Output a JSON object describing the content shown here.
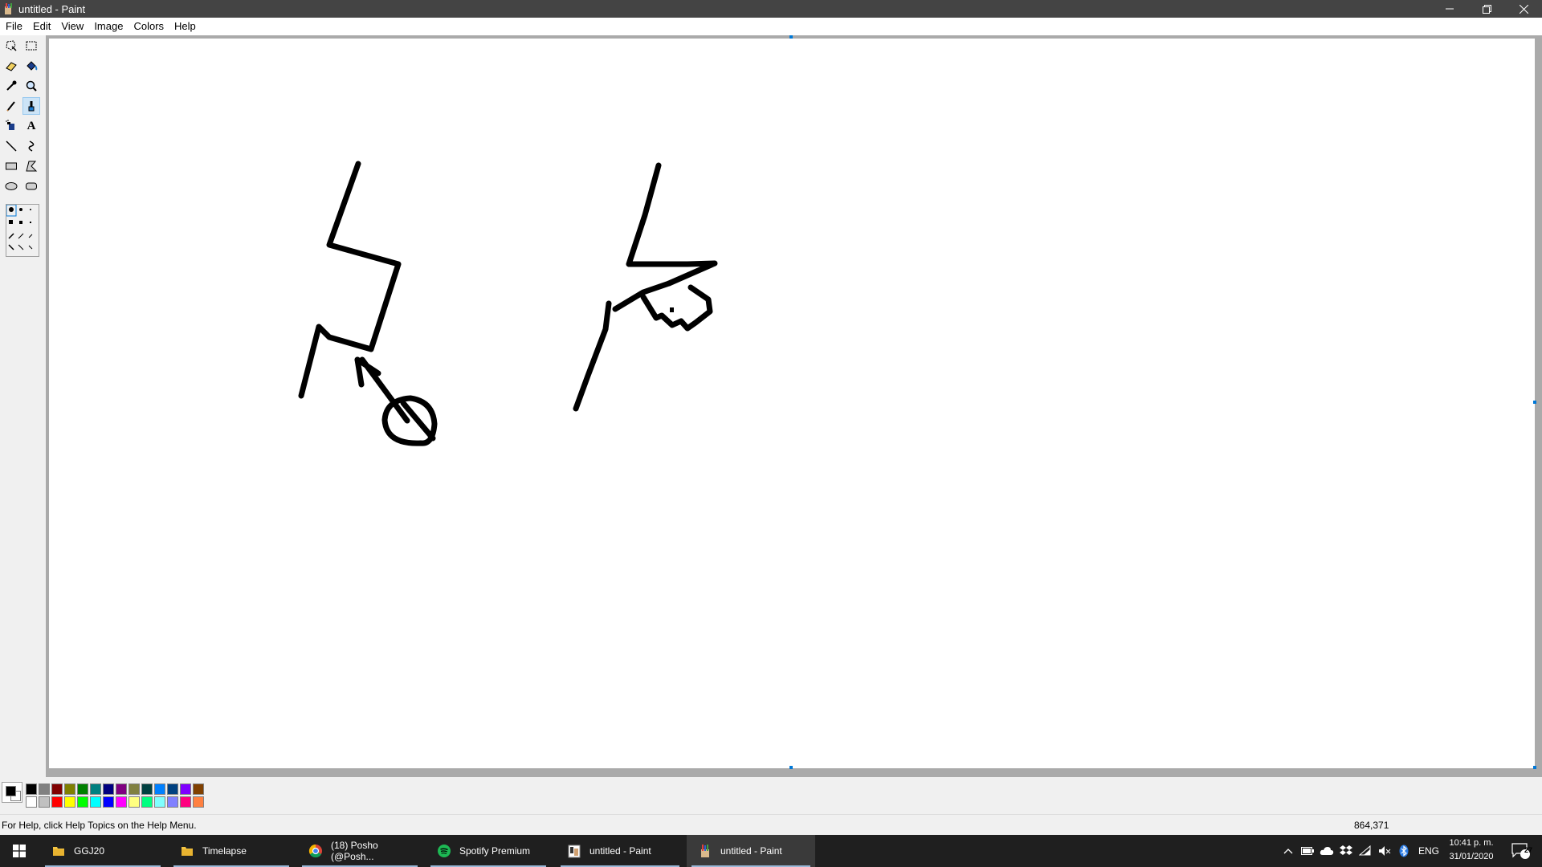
{
  "window": {
    "title": "untitled - Paint",
    "controls": {
      "minimize": "minimize-icon",
      "restore": "restore-icon",
      "close": "close-icon"
    }
  },
  "menu": [
    "File",
    "Edit",
    "View",
    "Image",
    "Colors",
    "Help"
  ],
  "tools": [
    {
      "name": "free-form-select",
      "icon": "freeform-select-icon"
    },
    {
      "name": "select",
      "icon": "rectangle-select-icon"
    },
    {
      "name": "eraser",
      "icon": "eraser-icon"
    },
    {
      "name": "fill-with-color",
      "icon": "paint-bucket-icon"
    },
    {
      "name": "pick-color",
      "icon": "eyedropper-icon"
    },
    {
      "name": "magnifier",
      "icon": "magnifier-icon"
    },
    {
      "name": "pencil",
      "icon": "pencil-icon"
    },
    {
      "name": "brush",
      "icon": "brush-icon",
      "selected": true
    },
    {
      "name": "airbrush",
      "icon": "airbrush-icon"
    },
    {
      "name": "text",
      "icon": "text-icon",
      "label": "A"
    },
    {
      "name": "line",
      "icon": "line-icon"
    },
    {
      "name": "curve",
      "icon": "curve-icon"
    },
    {
      "name": "rectangle",
      "icon": "rectangle-icon"
    },
    {
      "name": "polygon",
      "icon": "polygon-icon"
    },
    {
      "name": "ellipse",
      "icon": "ellipse-icon"
    },
    {
      "name": "rounded-rectangle",
      "icon": "rounded-rectangle-icon"
    }
  ],
  "palette": {
    "foreground": "#000000",
    "background": "#ffffff",
    "top_row": [
      "#000000",
      "#808080",
      "#800000",
      "#808000",
      "#008000",
      "#008080",
      "#000080",
      "#800080",
      "#808040",
      "#004040",
      "#0080ff",
      "#004080",
      "#8000ff",
      "#804000"
    ],
    "bottom_row": [
      "#ffffff",
      "#c0c0c0",
      "#ff0000",
      "#ffff00",
      "#00ff00",
      "#00ffff",
      "#0000ff",
      "#ff00ff",
      "#ffff80",
      "#00ff80",
      "#80ffff",
      "#8080ff",
      "#ff0080",
      "#ff8040"
    ]
  },
  "status": {
    "help_text": "For Help, click Help Topics on the Help Menu.",
    "coordinates": "864,371"
  },
  "taskbar": {
    "start": "windows-start-icon",
    "tasks": [
      {
        "label": "GGJ20",
        "icon": "folder-icon"
      },
      {
        "label": "Timelapse",
        "icon": "folder-icon"
      },
      {
        "label": "(18) Posho (@Posh...",
        "icon": "chrome-icon"
      },
      {
        "label": "Spotify Premium",
        "icon": "spotify-icon"
      },
      {
        "label": "untitled - Paint",
        "icon": "paint-icon"
      },
      {
        "label": "untitled - Paint",
        "icon": "paint-icon",
        "active": true
      }
    ],
    "tray": {
      "language": "ENG",
      "time": "10:41 p. m.",
      "date": "31/01/2020",
      "notifications": "27"
    }
  }
}
